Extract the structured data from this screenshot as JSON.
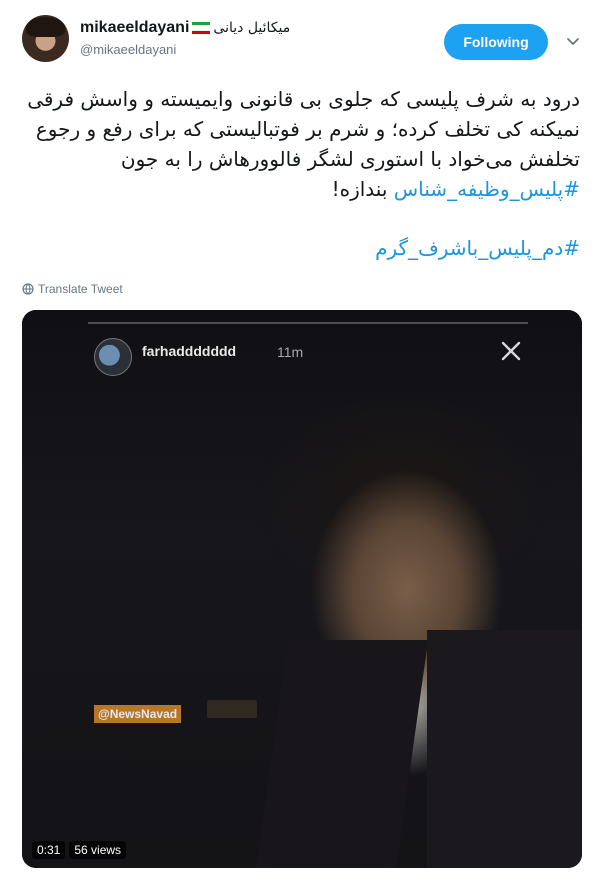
{
  "user": {
    "display_name": "mikaeeldayani",
    "display_name_fa": "میکائیل دیانی",
    "handle": "@mikaeeldayani"
  },
  "follow_button": {
    "label": "Following"
  },
  "tweet": {
    "paragraph1_text": "درود به شرف پلیسی که جلوی بی قانونی وایمیسته و واسش فرقی نمیکنه کی تخلف کرده؛ و شرم بر فوتبالیستی که برای رفع و رجوع تخلفش می‌خواد با استوری لشگر فالوورهاش را به جون ",
    "paragraph1_hashtag": "#پلیس_وظیفه_شناس",
    "paragraph1_end": " بندازه!",
    "paragraph2_hashtag": "#دم_پلیس_باشرف_گرم"
  },
  "translate_label": "Translate Tweet",
  "video": {
    "story_user": "farhaddddddd",
    "story_time": "11m",
    "watermark": "@NewsNavad",
    "duration": "0:31",
    "views": "56 views"
  },
  "colors": {
    "follow_button_bg": "#1da1f2",
    "hashtag": "#1b95e0",
    "secondary_text": "#657786"
  },
  "icons": {
    "flag": "iran-flag-icon",
    "caret": "chevron-down-icon",
    "translate": "globe-icon",
    "video_close": "close-icon"
  }
}
